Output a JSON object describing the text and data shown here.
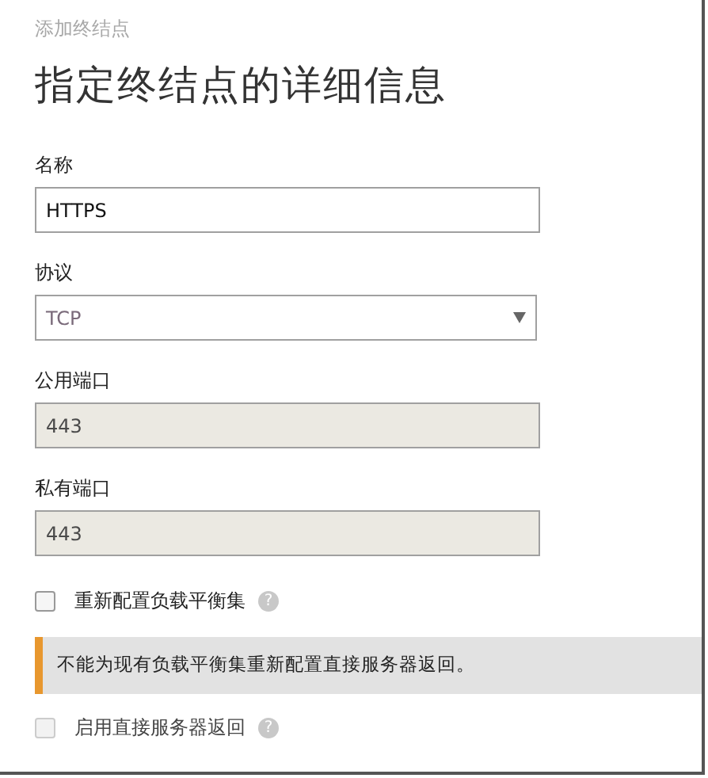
{
  "breadcrumb": "添加终结点",
  "title": "指定终结点的详细信息",
  "fields": [
    {
      "kind": "text",
      "label": "名称",
      "value": "HTTPS",
      "disabled": false
    },
    {
      "kind": "select",
      "label": "协议",
      "value": "TCP",
      "disabled": false
    },
    {
      "kind": "text",
      "label": "公用端口",
      "value": "443",
      "disabled": true
    },
    {
      "kind": "text",
      "label": "私有端口",
      "value": "443",
      "disabled": true
    }
  ],
  "options": [
    {
      "kind": "checkbox",
      "label": "重新配置负载平衡集",
      "checked": false,
      "disabled": false,
      "help": "?"
    },
    {
      "kind": "warning",
      "text": "不能为现有负载平衡集重新配置直接服务器返回。",
      "color": "#e8972e"
    },
    {
      "kind": "checkbox",
      "label": "启用直接服务器返回",
      "checked": false,
      "disabled": true,
      "help": "?"
    }
  ]
}
